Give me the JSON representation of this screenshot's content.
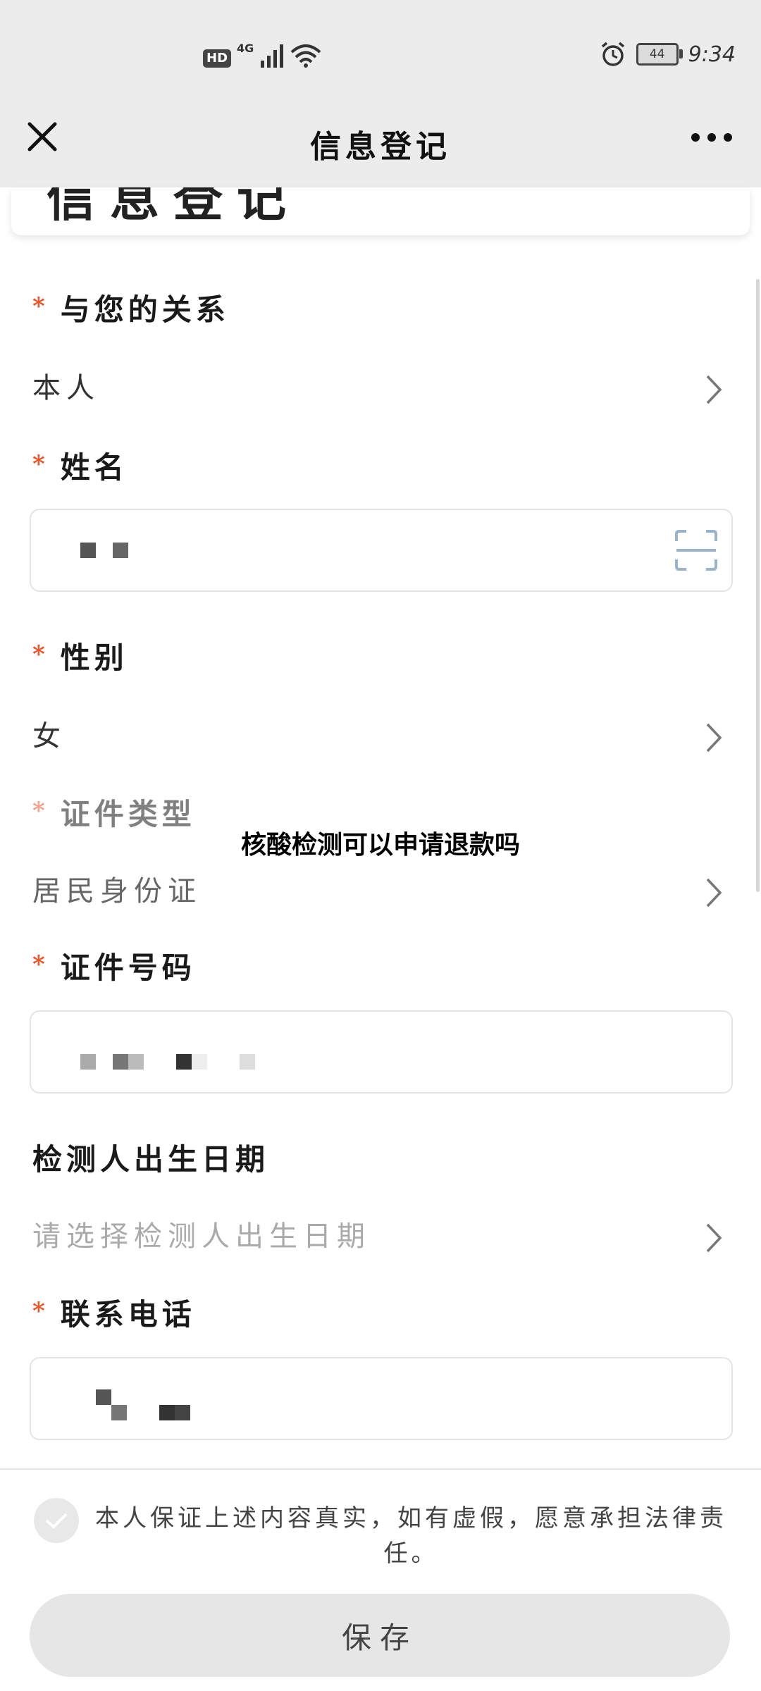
{
  "status_bar": {
    "hd": "HD",
    "network": "4G",
    "battery": "44",
    "time": "9:34"
  },
  "nav": {
    "title": "信息登记"
  },
  "form": {
    "relation": {
      "label": "与您的关系",
      "value": "本人"
    },
    "name": {
      "label": "姓名"
    },
    "gender": {
      "label": "性别",
      "value": "女"
    },
    "id_type": {
      "label": "证件类型",
      "value": "居民身份证"
    },
    "id_number": {
      "label": "证件号码"
    },
    "birth": {
      "label": "检测人出生日期",
      "placeholder": "请选择检测人出生日期"
    },
    "phone": {
      "label": "联系电话"
    }
  },
  "required_mark": "*",
  "overlay_caption": "核酸检测可以申请退款吗",
  "agreement": {
    "text": "本人保证上述内容真实，如有虚假，愿意承担法律责任。"
  },
  "save_label": "保存",
  "colors": {
    "accent_required": "#e4552b",
    "bar_bg": "#ececec"
  }
}
